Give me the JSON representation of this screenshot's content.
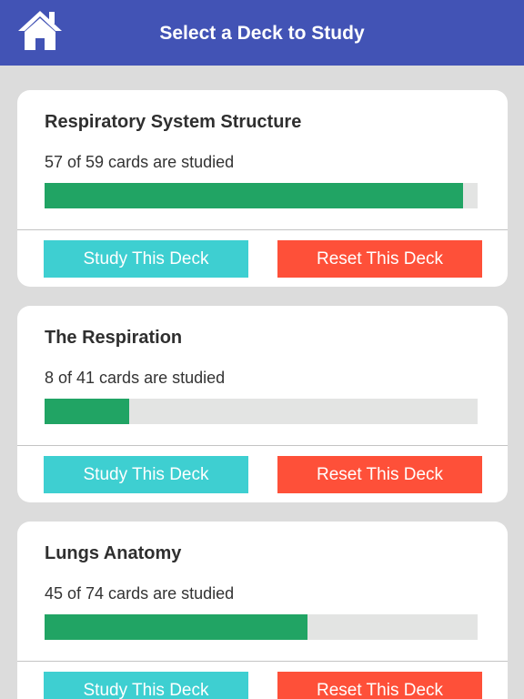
{
  "header": {
    "title": "Select a Deck to Study",
    "home_icon": "home-icon",
    "background_color": "#4253b5"
  },
  "colors": {
    "progress_fill": "#21a464",
    "progress_track": "#e3e4e3",
    "study_button": "#3ecfd1",
    "reset_button": "#fe5039"
  },
  "decks": [
    {
      "title": "Respiratory System Structure",
      "progress_text": "57 of 59 cards are studied",
      "studied": 57,
      "total": 59,
      "study_label": "Study This Deck",
      "reset_label": "Reset This Deck"
    },
    {
      "title": "The Respiration",
      "progress_text": "8 of 41 cards are studied",
      "studied": 8,
      "total": 41,
      "study_label": "Study This Deck",
      "reset_label": "Reset This Deck"
    },
    {
      "title": "Lungs Anatomy",
      "progress_text": "45 of 74 cards are studied",
      "studied": 45,
      "total": 74,
      "study_label": "Study This Deck",
      "reset_label": "Reset This Deck"
    }
  ]
}
